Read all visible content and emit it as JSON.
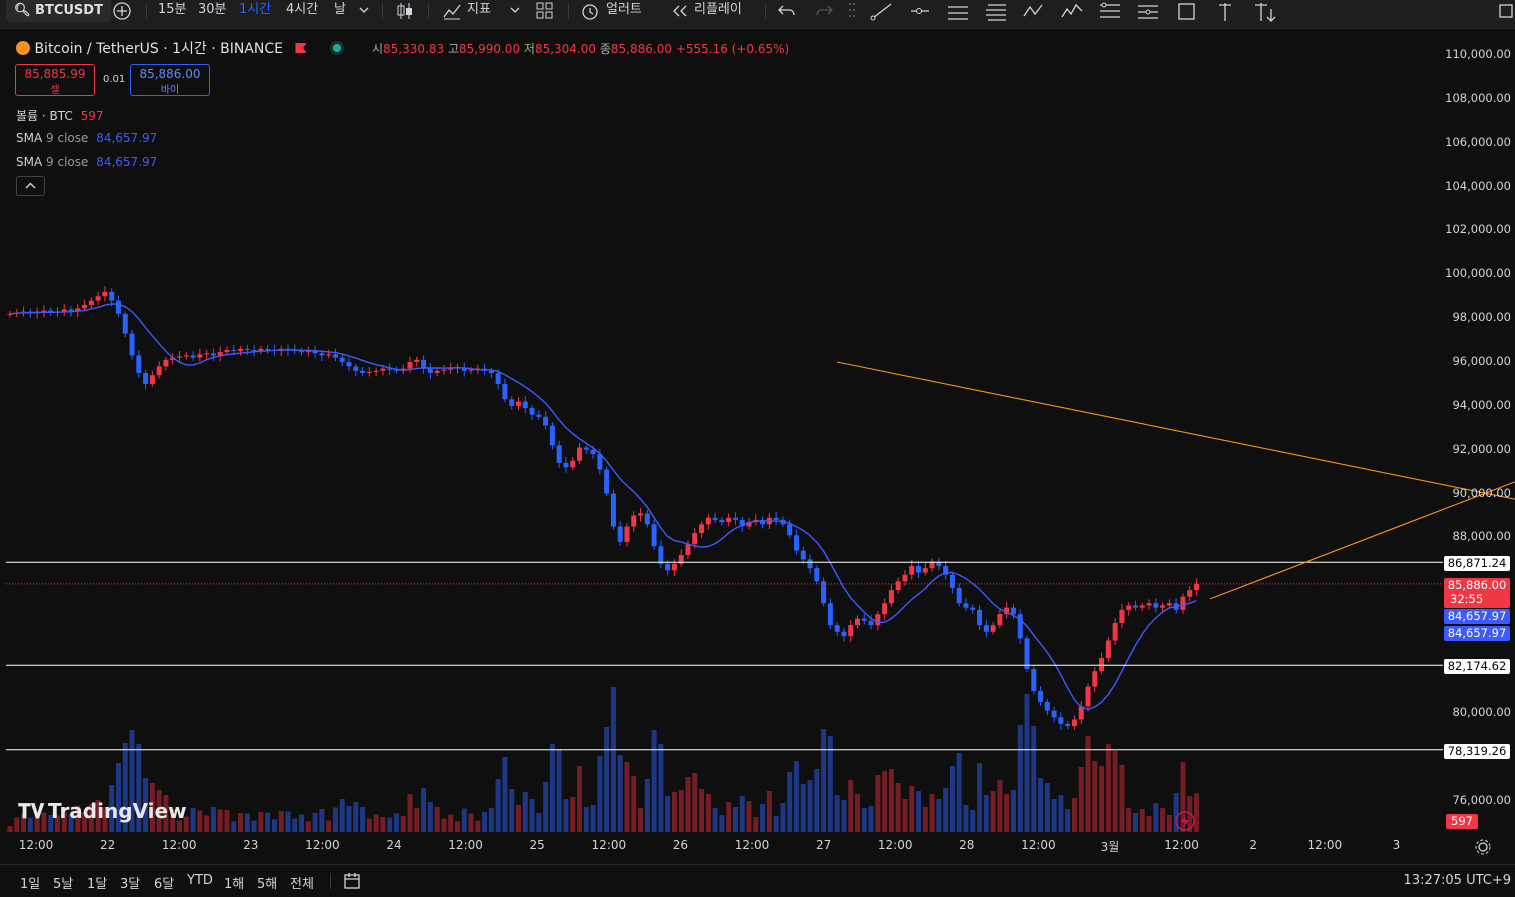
{
  "toolbar": {
    "symbol": "BTCUSDT",
    "intervals": [
      "15분",
      "30분",
      "1시간",
      "4시간",
      "날"
    ],
    "active_interval": "1시간",
    "indicators_label": "지표",
    "alert_label": "얼러트",
    "replay_label": "리플레이"
  },
  "legend": {
    "title": "Bitcoin / TetherUS · 1시간 · BINANCE",
    "open_label": "시",
    "open": "85,330.83",
    "high_label": "고",
    "high": "85,990.00",
    "low_label": "저",
    "low": "85,304.00",
    "close_label": "종",
    "close": "85,886.00",
    "change": "+555.16 (+0.65%)",
    "sell_price": "85,885.99",
    "sell_label": "셀",
    "spread": "0.01",
    "buy_price": "85,886.00",
    "buy_label": "바이",
    "volume_label": "볼륨 · BTC",
    "volume_value": "597",
    "sma1_label": "SMA",
    "sma1_params": "9 close",
    "sma1_value": "84,657.97",
    "sma2_label": "SMA",
    "sma2_params": "9 close",
    "sma2_value": "84,657.97",
    "collapse_icon": "chevron-up-icon"
  },
  "chart_data": {
    "type": "candlestick",
    "y_axis_ticks": [
      "110,000.00",
      "108,000.00",
      "106,000.00",
      "104,000.00",
      "102,000.00",
      "100,000.00",
      "98,000.00",
      "96,000.00",
      "94,000.00",
      "92,000.00",
      "90,000.00",
      "88,000.00",
      "80,000.00",
      "76,000.00"
    ],
    "ylim": [
      75000,
      110700
    ],
    "x_axis_ticks": [
      "12:00",
      "22",
      "12:00",
      "23",
      "12:00",
      "24",
      "12:00",
      "25",
      "12:00",
      "26",
      "12:00",
      "27",
      "12:00",
      "28",
      "12:00",
      "3월",
      "12:00",
      "2",
      "12:00",
      "3"
    ],
    "close_series": [
      98200,
      98250,
      98300,
      98220,
      98300,
      98350,
      98250,
      98300,
      98400,
      98300,
      98450,
      98600,
      98800,
      99000,
      99200,
      98800,
      98200,
      97300,
      96300,
      95500,
      95000,
      95400,
      95800,
      96100,
      96200,
      96250,
      96300,
      96200,
      96350,
      96400,
      96300,
      96450,
      96550,
      96500,
      96600,
      96550,
      96500,
      96600,
      96550,
      96500,
      96600,
      96550,
      96500,
      96450,
      96500,
      96400,
      96300,
      96350,
      96200,
      96000,
      95800,
      95600,
      95500,
      95550,
      95600,
      95700,
      95650,
      95600,
      95700,
      96000,
      96100,
      95700,
      95500,
      95600,
      95650,
      95700,
      95750,
      95600,
      95650,
      95700,
      95600,
      95500,
      95000,
      94300,
      94000,
      94200,
      93900,
      93600,
      93500,
      93100,
      92200,
      91400,
      91200,
      91500,
      92100,
      92000,
      91800,
      91100,
      90000,
      88500,
      87800,
      88500,
      89000,
      89100,
      88600,
      87600,
      86800,
      86500,
      86800,
      87200,
      87700,
      88200,
      88600,
      88900,
      88800,
      88700,
      88900,
      88800,
      88500,
      88700,
      88800,
      88600,
      88900,
      88800,
      88600,
      88100,
      87400,
      87000,
      86600,
      86000,
      85000,
      84000,
      83700,
      83500,
      84000,
      84300,
      84200,
      84000,
      84500,
      85000,
      85600,
      86000,
      86300,
      86700,
      86400,
      86600,
      86900,
      86700,
      86300,
      85700,
      85000,
      84800,
      84700,
      84000,
      83700,
      84000,
      84500,
      84800,
      84500,
      83400,
      82000,
      81000,
      80500,
      80100,
      79800,
      79500,
      79400,
      79700,
      80300,
      81200,
      81900,
      82500,
      83300,
      84100,
      84700,
      84900,
      84800,
      84900,
      85000,
      84800,
      84900,
      85000,
      84700,
      85300,
      85600,
      85886
    ],
    "sma_series_label": "SMA 9 close",
    "price_lines": [
      {
        "label": "86,871.24",
        "value": 86871.24
      },
      {
        "label": "82,174.62",
        "value": 82174.62
      },
      {
        "label": "78,319.26",
        "value": 78319.26
      }
    ],
    "current_price": {
      "label": "85,886.00",
      "value": 85886,
      "countdown": "32:55"
    },
    "sma_tags": [
      "84,657.97",
      "84,657.97"
    ],
    "volume_tag": "597",
    "trendlines": [
      {
        "from": {
          "index": 177,
          "price": 85200
        },
        "to": {
          "index": 236,
          "price": 92200
        }
      },
      {
        "from": {
          "index": 122,
          "price": 96000
        },
        "to": {
          "index": 343,
          "price": 82174.62
        }
      }
    ],
    "colors": {
      "up": "#f23645",
      "down": "#2962ff",
      "sma": "#3d5afe",
      "trend": "#f7931a"
    },
    "grid": false,
    "legend_position": "top-left"
  },
  "watermark": {
    "text": "TradingView"
  },
  "bottom": {
    "ranges": [
      "1일",
      "5날",
      "1달",
      "3달",
      "6달",
      "YTD",
      "1해",
      "5해",
      "전체"
    ],
    "time": "13:27:05 UTC+9"
  }
}
